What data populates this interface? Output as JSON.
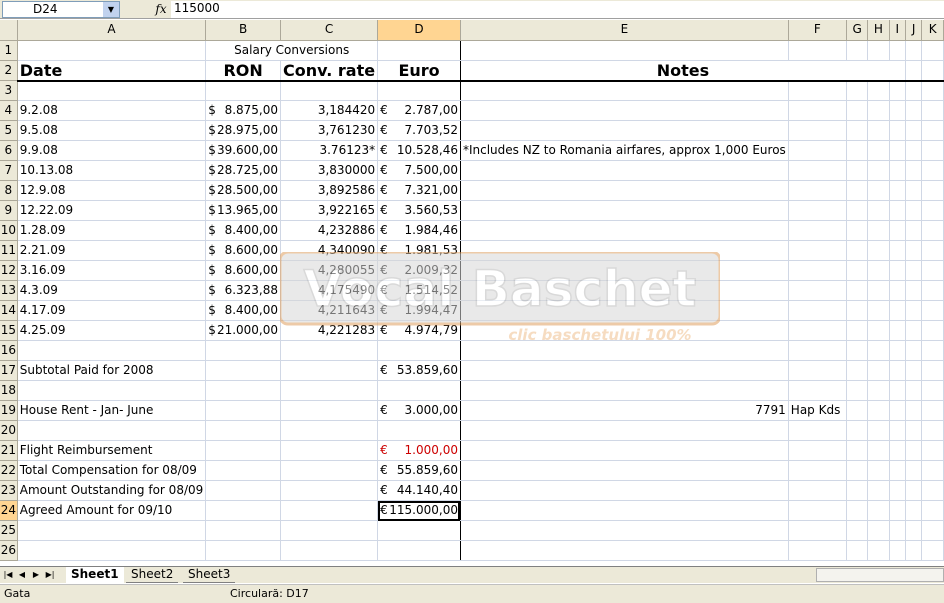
{
  "formula_bar": {
    "cell_ref": "D24",
    "fx": "fx",
    "value": "115000"
  },
  "columns": [
    "A",
    "B",
    "C",
    "D",
    "E",
    "F",
    "G",
    "H",
    "I",
    "J",
    "K"
  ],
  "rows": {
    "r1": {
      "num": "1",
      "b": "Salary Conversions"
    },
    "r2": {
      "num": "2",
      "a": "Date",
      "b": "RON",
      "c": "Conv. rate",
      "d": "Euro",
      "notes": "Notes"
    },
    "r3": {
      "num": "3"
    },
    "r4": {
      "num": "4",
      "a": "9.2.08",
      "b_sym": "$",
      "b": "8.875,00",
      "c": "3,184420",
      "d_sym": "€",
      "d": "2.787,00"
    },
    "r5": {
      "num": "5",
      "a": "9.5.08",
      "b_sym": "$",
      "b": "28.975,00",
      "c": "3,761230",
      "d_sym": "€",
      "d": "7.703,52"
    },
    "r6": {
      "num": "6",
      "a": "9.9.08",
      "b_sym": "$",
      "b": "39.600,00",
      "c": "3.76123*",
      "d_sym": "€",
      "d": "10.528,46",
      "e": "*Includes NZ to Romania airfares, approx 1,000 Euros"
    },
    "r7": {
      "num": "7",
      "a": "10.13.08",
      "b_sym": "$",
      "b": "28.725,00",
      "c": "3,830000",
      "d_sym": "€",
      "d": "7.500,00"
    },
    "r8": {
      "num": "8",
      "a": "12.9.08",
      "b_sym": "$",
      "b": "28.500,00",
      "c": "3,892586",
      "d_sym": "€",
      "d": "7.321,00"
    },
    "r9": {
      "num": "9",
      "a": "12.22.09",
      "b_sym": "$",
      "b": "13.965,00",
      "c": "3,922165",
      "d_sym": "€",
      "d": "3.560,53"
    },
    "r10": {
      "num": "10",
      "a": "1.28.09",
      "b_sym": "$",
      "b": "8.400,00",
      "c": "4,232886",
      "d_sym": "€",
      "d": "1.984,46"
    },
    "r11": {
      "num": "11",
      "a": "2.21.09",
      "b_sym": "$",
      "b": "8.600,00",
      "c": "4,340090",
      "d_sym": "€",
      "d": "1.981,53"
    },
    "r12": {
      "num": "12",
      "a": "3.16.09",
      "b_sym": "$",
      "b": "8.600,00",
      "c": "4,280055",
      "d_sym": "€",
      "d": "2.009,32"
    },
    "r13": {
      "num": "13",
      "a": "4.3.09",
      "b_sym": "$",
      "b": "6.323,88",
      "c": "4,175490",
      "d_sym": "€",
      "d": "1.514,52"
    },
    "r14": {
      "num": "14",
      "a": "4.17.09",
      "b_sym": "$",
      "b": "8.400,00",
      "c": "4,211643",
      "d_sym": "€",
      "d": "1.994,47"
    },
    "r15": {
      "num": "15",
      "a": "4.25.09",
      "b_sym": "$",
      "b": "21.000,00",
      "c": "4,221283",
      "d_sym": "€",
      "d": "4.974,79"
    },
    "r16": {
      "num": "16"
    },
    "r17": {
      "num": "17",
      "a": "Subtotal Paid for 2008",
      "d_sym": "€",
      "d": "53.859,60"
    },
    "r18": {
      "num": "18"
    },
    "r19": {
      "num": "19",
      "a": "House Rent - Jan- June",
      "d_sym": "€",
      "d": "3.000,00",
      "e": "7791",
      "f": "Hap Kds"
    },
    "r20": {
      "num": "20"
    },
    "r21": {
      "num": "21",
      "a": "Flight Reimbursement",
      "d_sym": "€",
      "d": "1.000,00"
    },
    "r22": {
      "num": "22",
      "a": "Total Compensation for 08/09",
      "d_sym": "€",
      "d": "55.859,60"
    },
    "r23": {
      "num": "23",
      "a": "Amount Outstanding for 08/09",
      "d_sym": "€",
      "d": "44.140,40"
    },
    "r24": {
      "num": "24",
      "a": "Agreed Amount for 09/10",
      "d_sym": "€",
      "d": "115.000,00"
    },
    "r25": {
      "num": "25"
    },
    "r26": {
      "num": "26"
    }
  },
  "tabs": [
    "Sheet1",
    "Sheet2",
    "Sheet3"
  ],
  "status": {
    "left": "Gata",
    "middle": "Circulară: D17"
  },
  "watermark": {
    "line1": "Vocal Baschet",
    "line2": "clic baschetului 100%"
  },
  "colors": {
    "header_bg": "#ece9d8",
    "selected_header": "#ffd592",
    "negative_red": "#cc0000"
  }
}
